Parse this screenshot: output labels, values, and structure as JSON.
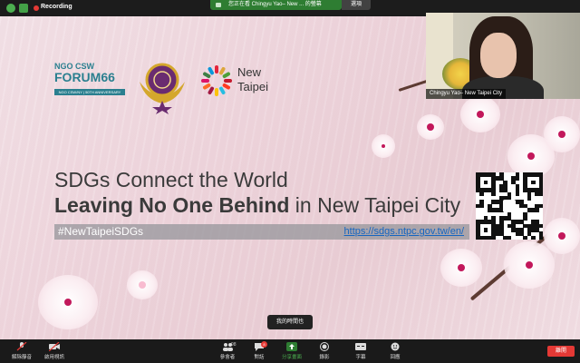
{
  "top_bar": {
    "recording_label": "Recording",
    "share_banner_text": "您正在看 Chingyu Yao– New ... 的螢幕",
    "options_label": "選項"
  },
  "slide": {
    "ngo_top": "NGO CSW",
    "ngo_forum": "FORUM66",
    "ngo_strip": "NGO CSW/NY | 50TH ANNIVERSARY",
    "ntp_line1": "New",
    "ntp_line2": "Taipei",
    "title_line1": "SDGs Connect the World",
    "title_line2_bold": "Leaving No One Behind",
    "title_line2_rest": " in New Taipei City",
    "hashtag": "#NewTaipeiSDGs",
    "url": "https://sdgs.ntpc.gov.tw/en/"
  },
  "video": {
    "participant_name": "Chingyu Yao– New Taipei City"
  },
  "tooltip": {
    "text": "我的時間也"
  },
  "bottom_bar": {
    "mute_label": "解除靜音",
    "video_label": "啟用視訊",
    "participants_label": "參會者",
    "participants_count": "98",
    "chat_label": "對話",
    "chat_badge": "8",
    "share_label": "分享畫面",
    "record_label": "錄影",
    "captions_label": "字幕",
    "reactions_label": "回應",
    "end_label": "離開"
  },
  "colors": {
    "share_green": "#2e7d32",
    "end_red": "#e53935",
    "ngo_teal": "#2a7f8f",
    "url_blue": "#1565c0"
  }
}
